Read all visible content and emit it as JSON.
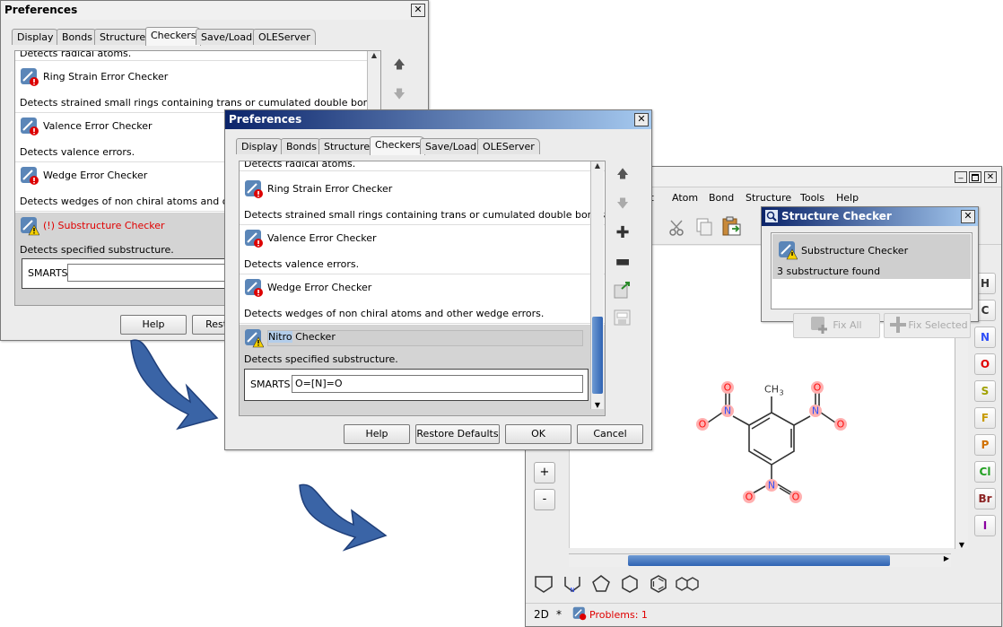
{
  "pref_dialog": {
    "title": "Preferences",
    "close": "✕",
    "tabs": [
      "Display",
      "Bonds",
      "Structure",
      "Checkers",
      "Save/Load",
      "OLEServer"
    ],
    "buttons": {
      "help": "Help",
      "restore": "Restore Defaults",
      "ok": "OK",
      "cancel": "Cancel"
    }
  },
  "back_dialog": {
    "partial_top": "Detects radical atoms.",
    "items": [
      {
        "name": "Ring Strain Error Checker",
        "desc": "Detects strained small rings containing trans or cumulated double bonds, or ..."
      },
      {
        "name": "Valence Error Checker",
        "desc": "Detects valence errors."
      },
      {
        "name": "Wedge Error Checker",
        "desc": "Detects wedges of non chiral atoms and other w"
      }
    ],
    "selected": {
      "name": "(!) Substructure Checker",
      "desc": "Detects specified substructure."
    },
    "smarts_label": "SMARTS",
    "smarts_value": "",
    "buttons": {
      "help": "Help",
      "restore": "Restore"
    }
  },
  "front_dialog": {
    "partial_top": "Detects radical atoms.",
    "items": [
      {
        "name": "Ring Strain Error Checker",
        "desc": "Detects strained small rings containing trans or cumulated double bonds, or ..."
      },
      {
        "name": "Valence Error Checker",
        "desc": "Detects valence errors."
      },
      {
        "name": "Wedge Error Checker",
        "desc": "Detects wedges of non chiral atoms and other wedge errors."
      }
    ],
    "selected": {
      "name_sel": "Nitro",
      "name_rest": " Checker",
      "desc": "Detects specified substructure."
    },
    "smarts_label": "SMARTS",
    "smarts_value": "O=[N]=O"
  },
  "editor": {
    "menu_partial": "rt",
    "menus": [
      "Atom",
      "Bond",
      "Structure",
      "Tools",
      "Help"
    ],
    "elements": [
      "H",
      "C",
      "N",
      "O",
      "S",
      "F",
      "P",
      "Cl",
      "Br",
      "I"
    ],
    "zoom": [
      "+",
      "-"
    ],
    "status_mode": "2D",
    "status_star": "*",
    "status_problems": "Problems: 1",
    "molecule": {
      "methyl": "CH",
      "methyl_sub": "3",
      "n": "N",
      "o": "O"
    }
  },
  "structure_checker": {
    "title": "Structure Checker",
    "close": "✕",
    "item_name": "Substructure Checker",
    "item_desc": "3 substructure found",
    "fix_all": "Fix All",
    "fix_selected": "Fix Selected"
  },
  "colors": {
    "title_dark": "#0b246a",
    "title_light": "#a6caf0",
    "arrow": "#3a64a6",
    "error_text": "#e00000",
    "atom_highlight": "#ffa0a0",
    "nitrogen": "#3050f8",
    "oxygen": "#ff0d0d"
  }
}
